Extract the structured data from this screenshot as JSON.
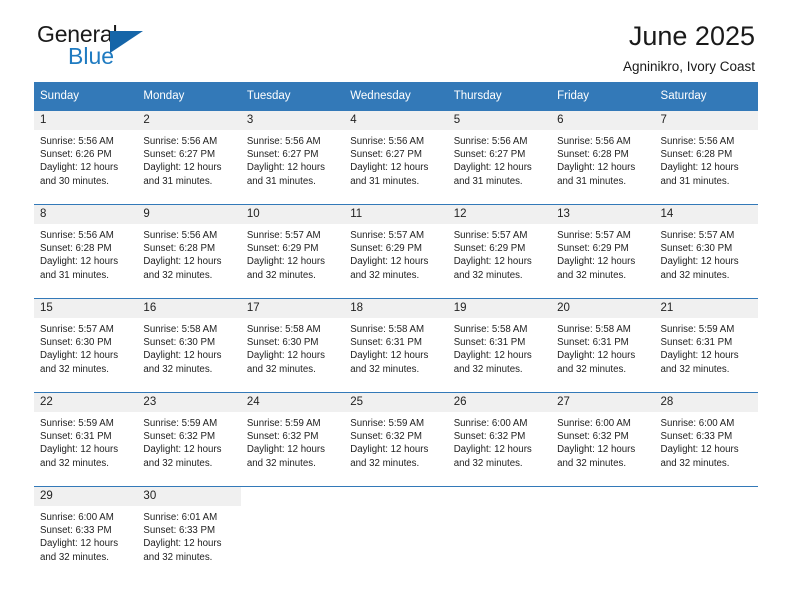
{
  "logo": {
    "word_top": "General",
    "word_bottom": "Blue",
    "triangle_icon": "triangle-icon",
    "brand_color": "#1f7bc1"
  },
  "header": {
    "title": "June 2025",
    "subtitle": "Agninikro, Ivory Coast"
  },
  "calendar": {
    "header_bg": "#3379b8",
    "daynum_bg": "#f0f0f0",
    "weekdays": [
      "Sunday",
      "Monday",
      "Tuesday",
      "Wednesday",
      "Thursday",
      "Friday",
      "Saturday"
    ],
    "weeks": [
      [
        {
          "day": "1",
          "sunrise": "Sunrise: 5:56 AM",
          "sunset": "Sunset: 6:26 PM",
          "daylight_line1": "Daylight: 12 hours",
          "daylight_line2": "and 30 minutes."
        },
        {
          "day": "2",
          "sunrise": "Sunrise: 5:56 AM",
          "sunset": "Sunset: 6:27 PM",
          "daylight_line1": "Daylight: 12 hours",
          "daylight_line2": "and 31 minutes."
        },
        {
          "day": "3",
          "sunrise": "Sunrise: 5:56 AM",
          "sunset": "Sunset: 6:27 PM",
          "daylight_line1": "Daylight: 12 hours",
          "daylight_line2": "and 31 minutes."
        },
        {
          "day": "4",
          "sunrise": "Sunrise: 5:56 AM",
          "sunset": "Sunset: 6:27 PM",
          "daylight_line1": "Daylight: 12 hours",
          "daylight_line2": "and 31 minutes."
        },
        {
          "day": "5",
          "sunrise": "Sunrise: 5:56 AM",
          "sunset": "Sunset: 6:27 PM",
          "daylight_line1": "Daylight: 12 hours",
          "daylight_line2": "and 31 minutes."
        },
        {
          "day": "6",
          "sunrise": "Sunrise: 5:56 AM",
          "sunset": "Sunset: 6:28 PM",
          "daylight_line1": "Daylight: 12 hours",
          "daylight_line2": "and 31 minutes."
        },
        {
          "day": "7",
          "sunrise": "Sunrise: 5:56 AM",
          "sunset": "Sunset: 6:28 PM",
          "daylight_line1": "Daylight: 12 hours",
          "daylight_line2": "and 31 minutes."
        }
      ],
      [
        {
          "day": "8",
          "sunrise": "Sunrise: 5:56 AM",
          "sunset": "Sunset: 6:28 PM",
          "daylight_line1": "Daylight: 12 hours",
          "daylight_line2": "and 31 minutes."
        },
        {
          "day": "9",
          "sunrise": "Sunrise: 5:56 AM",
          "sunset": "Sunset: 6:28 PM",
          "daylight_line1": "Daylight: 12 hours",
          "daylight_line2": "and 32 minutes."
        },
        {
          "day": "10",
          "sunrise": "Sunrise: 5:57 AM",
          "sunset": "Sunset: 6:29 PM",
          "daylight_line1": "Daylight: 12 hours",
          "daylight_line2": "and 32 minutes."
        },
        {
          "day": "11",
          "sunrise": "Sunrise: 5:57 AM",
          "sunset": "Sunset: 6:29 PM",
          "daylight_line1": "Daylight: 12 hours",
          "daylight_line2": "and 32 minutes."
        },
        {
          "day": "12",
          "sunrise": "Sunrise: 5:57 AM",
          "sunset": "Sunset: 6:29 PM",
          "daylight_line1": "Daylight: 12 hours",
          "daylight_line2": "and 32 minutes."
        },
        {
          "day": "13",
          "sunrise": "Sunrise: 5:57 AM",
          "sunset": "Sunset: 6:29 PM",
          "daylight_line1": "Daylight: 12 hours",
          "daylight_line2": "and 32 minutes."
        },
        {
          "day": "14",
          "sunrise": "Sunrise: 5:57 AM",
          "sunset": "Sunset: 6:30 PM",
          "daylight_line1": "Daylight: 12 hours",
          "daylight_line2": "and 32 minutes."
        }
      ],
      [
        {
          "day": "15",
          "sunrise": "Sunrise: 5:57 AM",
          "sunset": "Sunset: 6:30 PM",
          "daylight_line1": "Daylight: 12 hours",
          "daylight_line2": "and 32 minutes."
        },
        {
          "day": "16",
          "sunrise": "Sunrise: 5:58 AM",
          "sunset": "Sunset: 6:30 PM",
          "daylight_line1": "Daylight: 12 hours",
          "daylight_line2": "and 32 minutes."
        },
        {
          "day": "17",
          "sunrise": "Sunrise: 5:58 AM",
          "sunset": "Sunset: 6:30 PM",
          "daylight_line1": "Daylight: 12 hours",
          "daylight_line2": "and 32 minutes."
        },
        {
          "day": "18",
          "sunrise": "Sunrise: 5:58 AM",
          "sunset": "Sunset: 6:31 PM",
          "daylight_line1": "Daylight: 12 hours",
          "daylight_line2": "and 32 minutes."
        },
        {
          "day": "19",
          "sunrise": "Sunrise: 5:58 AM",
          "sunset": "Sunset: 6:31 PM",
          "daylight_line1": "Daylight: 12 hours",
          "daylight_line2": "and 32 minutes."
        },
        {
          "day": "20",
          "sunrise": "Sunrise: 5:58 AM",
          "sunset": "Sunset: 6:31 PM",
          "daylight_line1": "Daylight: 12 hours",
          "daylight_line2": "and 32 minutes."
        },
        {
          "day": "21",
          "sunrise": "Sunrise: 5:59 AM",
          "sunset": "Sunset: 6:31 PM",
          "daylight_line1": "Daylight: 12 hours",
          "daylight_line2": "and 32 minutes."
        }
      ],
      [
        {
          "day": "22",
          "sunrise": "Sunrise: 5:59 AM",
          "sunset": "Sunset: 6:31 PM",
          "daylight_line1": "Daylight: 12 hours",
          "daylight_line2": "and 32 minutes."
        },
        {
          "day": "23",
          "sunrise": "Sunrise: 5:59 AM",
          "sunset": "Sunset: 6:32 PM",
          "daylight_line1": "Daylight: 12 hours",
          "daylight_line2": "and 32 minutes."
        },
        {
          "day": "24",
          "sunrise": "Sunrise: 5:59 AM",
          "sunset": "Sunset: 6:32 PM",
          "daylight_line1": "Daylight: 12 hours",
          "daylight_line2": "and 32 minutes."
        },
        {
          "day": "25",
          "sunrise": "Sunrise: 5:59 AM",
          "sunset": "Sunset: 6:32 PM",
          "daylight_line1": "Daylight: 12 hours",
          "daylight_line2": "and 32 minutes."
        },
        {
          "day": "26",
          "sunrise": "Sunrise: 6:00 AM",
          "sunset": "Sunset: 6:32 PM",
          "daylight_line1": "Daylight: 12 hours",
          "daylight_line2": "and 32 minutes."
        },
        {
          "day": "27",
          "sunrise": "Sunrise: 6:00 AM",
          "sunset": "Sunset: 6:32 PM",
          "daylight_line1": "Daylight: 12 hours",
          "daylight_line2": "and 32 minutes."
        },
        {
          "day": "28",
          "sunrise": "Sunrise: 6:00 AM",
          "sunset": "Sunset: 6:33 PM",
          "daylight_line1": "Daylight: 12 hours",
          "daylight_line2": "and 32 minutes."
        }
      ],
      [
        {
          "day": "29",
          "sunrise": "Sunrise: 6:00 AM",
          "sunset": "Sunset: 6:33 PM",
          "daylight_line1": "Daylight: 12 hours",
          "daylight_line2": "and 32 minutes."
        },
        {
          "day": "30",
          "sunrise": "Sunrise: 6:01 AM",
          "sunset": "Sunset: 6:33 PM",
          "daylight_line1": "Daylight: 12 hours",
          "daylight_line2": "and 32 minutes."
        },
        {
          "day": "",
          "sunrise": "",
          "sunset": "",
          "daylight_line1": "",
          "daylight_line2": ""
        },
        {
          "day": "",
          "sunrise": "",
          "sunset": "",
          "daylight_line1": "",
          "daylight_line2": ""
        },
        {
          "day": "",
          "sunrise": "",
          "sunset": "",
          "daylight_line1": "",
          "daylight_line2": ""
        },
        {
          "day": "",
          "sunrise": "",
          "sunset": "",
          "daylight_line1": "",
          "daylight_line2": ""
        },
        {
          "day": "",
          "sunrise": "",
          "sunset": "",
          "daylight_line1": "",
          "daylight_line2": ""
        }
      ]
    ]
  }
}
